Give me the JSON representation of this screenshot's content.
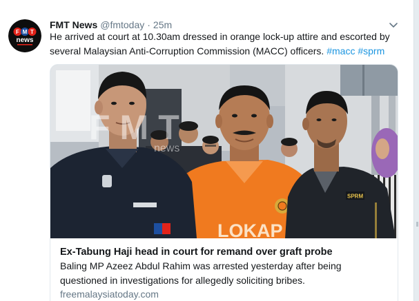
{
  "tweet": {
    "author": {
      "name": "FMT News",
      "handle": "@fmtoday"
    },
    "separator": "·",
    "timestamp": "25m",
    "text": "He arrived at court at 10.30am dressed in orange lock-up attire and escorted by several Malaysian Anti-Corruption Commission (MACC) officers.",
    "hashtags": [
      "#macc",
      "#sprm"
    ]
  },
  "avatar": {
    "logo_letters": [
      "F",
      "M",
      "T"
    ],
    "logo_word": "news",
    "logo_colors": [
      "#e2231a",
      "#1d4fa0",
      "#e2231a"
    ]
  },
  "card": {
    "title": "Ex-Tabung Haji head in court for remand over graft probe",
    "description": "Baling MP Azeez Abdul Rahim was arrested yesterday after being questioned in investigations for allegedly soliciting bribes.",
    "domain": "freemalaysiatoday.com"
  },
  "photo": {
    "watermark_letters": "FMT",
    "watermark_word": "news",
    "shirt_text": "LOKAP",
    "badge_text": "SPRM"
  },
  "icons": {
    "more_options": "chevron-down-icon"
  },
  "colors": {
    "primary_text": "#14171a",
    "secondary_text": "#657786",
    "link": "#1b95e0",
    "card_border": "#e1e8ed",
    "shirt_orange": "#f07a1f"
  }
}
